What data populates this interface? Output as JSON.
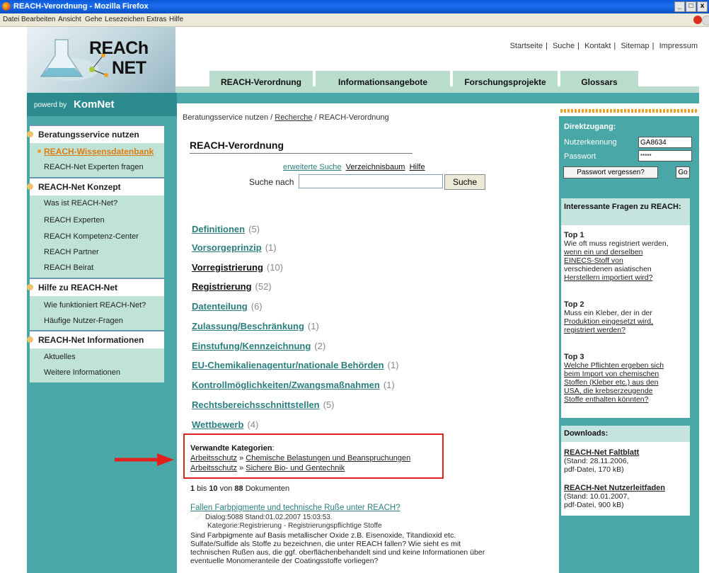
{
  "window": {
    "title": "REACH-Verordnung - Mozilla Firefox",
    "controls": [
      "_",
      "□",
      "x"
    ]
  },
  "menu": [
    "Datei",
    "Bearbeiten",
    "Ansicht",
    "Gehe",
    "Lesezeichen",
    "Extras",
    "Hilfe"
  ],
  "logo": {
    "line1": "REACh",
    "line2": "NET"
  },
  "toplinks": [
    "Startseite",
    "Suche",
    "Kontakt",
    "Sitemap",
    "Impressum"
  ],
  "tabs": [
    "REACH-Verordnung",
    "Informationsangebote",
    "Forschungsprojekte",
    "Glossars"
  ],
  "powered": {
    "prefix": "powerd by",
    "brand": "KomNet"
  },
  "nav": {
    "s1": {
      "title": "Beratungsservice nutzen",
      "items": [
        "REACH-Wissensdatenbank",
        "REACH-Net Experten fragen"
      ]
    },
    "s2": {
      "title": "REACH-Net Konzept",
      "items": [
        "Was ist REACH-Net?",
        "REACH Experten",
        "REACH Kompetenz-Center",
        "REACH Partner",
        "REACH Beirat"
      ]
    },
    "s3": {
      "title": "Hilfe zu REACH-Net",
      "items": [
        "Wie funktioniert REACH-Net?",
        "Häufige Nutzer-Fragen"
      ]
    },
    "s4": {
      "title": "REACH-Net Informationen",
      "items": [
        "Aktuelles",
        "Weitere Informationen"
      ]
    }
  },
  "breadcrumb": {
    "a": "Beratungsservice nutzen /",
    "b": "Recherche",
    "c": "/ REACH-Verordnung"
  },
  "page_title": "REACH-Verordnung",
  "search": {
    "links": [
      "erweiterte Suche",
      "Verzeichnisbaum",
      "Hilfe"
    ],
    "label": "Suche nach",
    "value": "",
    "button": "Suche"
  },
  "categories": [
    {
      "name": "Definitionen",
      "count": "(5)"
    },
    {
      "name": "Vorsorgeprinzip",
      "count": "(1)"
    },
    {
      "name": "Vorregistrierung",
      "count": "(10)"
    },
    {
      "name": "Registrierung",
      "count": "(52)"
    },
    {
      "name": "Datenteilung",
      "count": "(6)"
    },
    {
      "name": "Zulassung/Beschränkung",
      "count": "(1)"
    },
    {
      "name": "Einstufung/Kennzeichnung",
      "count": "(2)"
    },
    {
      "name": "EU-Chemikalienagentur/nationale Behörden",
      "count": "(1)"
    },
    {
      "name": "Kontrollmöglichkeiten/Zwangsmaßnahmen",
      "count": "(1)"
    },
    {
      "name": "Rechtsbereichsschnittstellen",
      "count": "(5)"
    },
    {
      "name": "Wettbewerb",
      "count": "(4)"
    }
  ],
  "related": {
    "title": "Verwandte Kategorien",
    "colon": ":",
    "rows": [
      {
        "a": "Arbeitsschutz",
        "sep": " » ",
        "b": "Chemische Belastungen und Beanspruchungen"
      },
      {
        "a": "Arbeitsschutz",
        "sep": " » ",
        "b": "Sichere Bio- und Gentechnik"
      }
    ]
  },
  "results": {
    "from": "1",
    "bis": " bis ",
    "to": "10",
    "von": " von ",
    "total": "88",
    "suffix": " Dokumenten"
  },
  "result1": {
    "title": "Fallen Farbpigmente und technische Ruße unter REACH?",
    "meta1": "Dialog:5088 Stand:01.02.2007 15:03:53.",
    "meta2": "Kategorie:Registrierung - Registrierungspflichtige Stoffe",
    "body1": "Sind Farbpigmente auf Basis metallischer Oxide z.B. Eisenoxide, Titandioxid etc.",
    "body2": "Sulfate/Sulfide als Stoffe zu bezeichnen, die unter REACH fallen? Wie sieht es mit",
    "body3": "technischen Rußen aus, die ggf. oberflächenbehandelt sind und keine Informationen über",
    "body4": "eventuelle Monomeranteile der Coatingsstoffe vorliegen?"
  },
  "login": {
    "title": "Direktzugang:",
    "user_label": "Nutzerkennung",
    "user_value": "GA8634",
    "pass_label": "Passwort",
    "pass_value": "*****",
    "forgot": "Passwort vergessen?",
    "go": "Go"
  },
  "faq": {
    "title": "Interessante Fragen zu REACH:",
    "items": [
      {
        "top": "Top 1",
        "lines": [
          "Wie oft muss registriert werden,",
          "wenn ein und derselben",
          "EINECS-Stoff von",
          "verschiedenen asiatischen",
          "Herstellern importiert wird?"
        ]
      },
      {
        "top": "Top 2",
        "lines": [
          "Muss ein Kleber, der in der",
          "Produktion eingesetzt wird,",
          "registriert werden?"
        ]
      },
      {
        "top": "Top 3",
        "lines": [
          "Welche Pflichten ergeben sich",
          "beim Import von chemischen",
          "Stoffen (Kleber etc.) aus den",
          "USA, die krebserzeugende",
          "Stoffe enthalten könnten?"
        ]
      }
    ]
  },
  "downloads": {
    "title": "Downloads:",
    "items": [
      {
        "name": "REACH-Net Faltblatt",
        "l1": "(Stand: 28.11.2006,",
        "l2": "pdf-Datei, 170 kB)"
      },
      {
        "name": "REACH-Net Nutzerleitfaden",
        "l1": "(Stand: 10.01.2007,",
        "l2": "pdf-Datei, 900 kB)"
      }
    ]
  },
  "colors": {
    "teal": "#4aa7a7",
    "tab": "#b9dccd",
    "highlight": "#e0221c",
    "link": "#2a7e7e",
    "accent_orange": "#f0a020"
  }
}
